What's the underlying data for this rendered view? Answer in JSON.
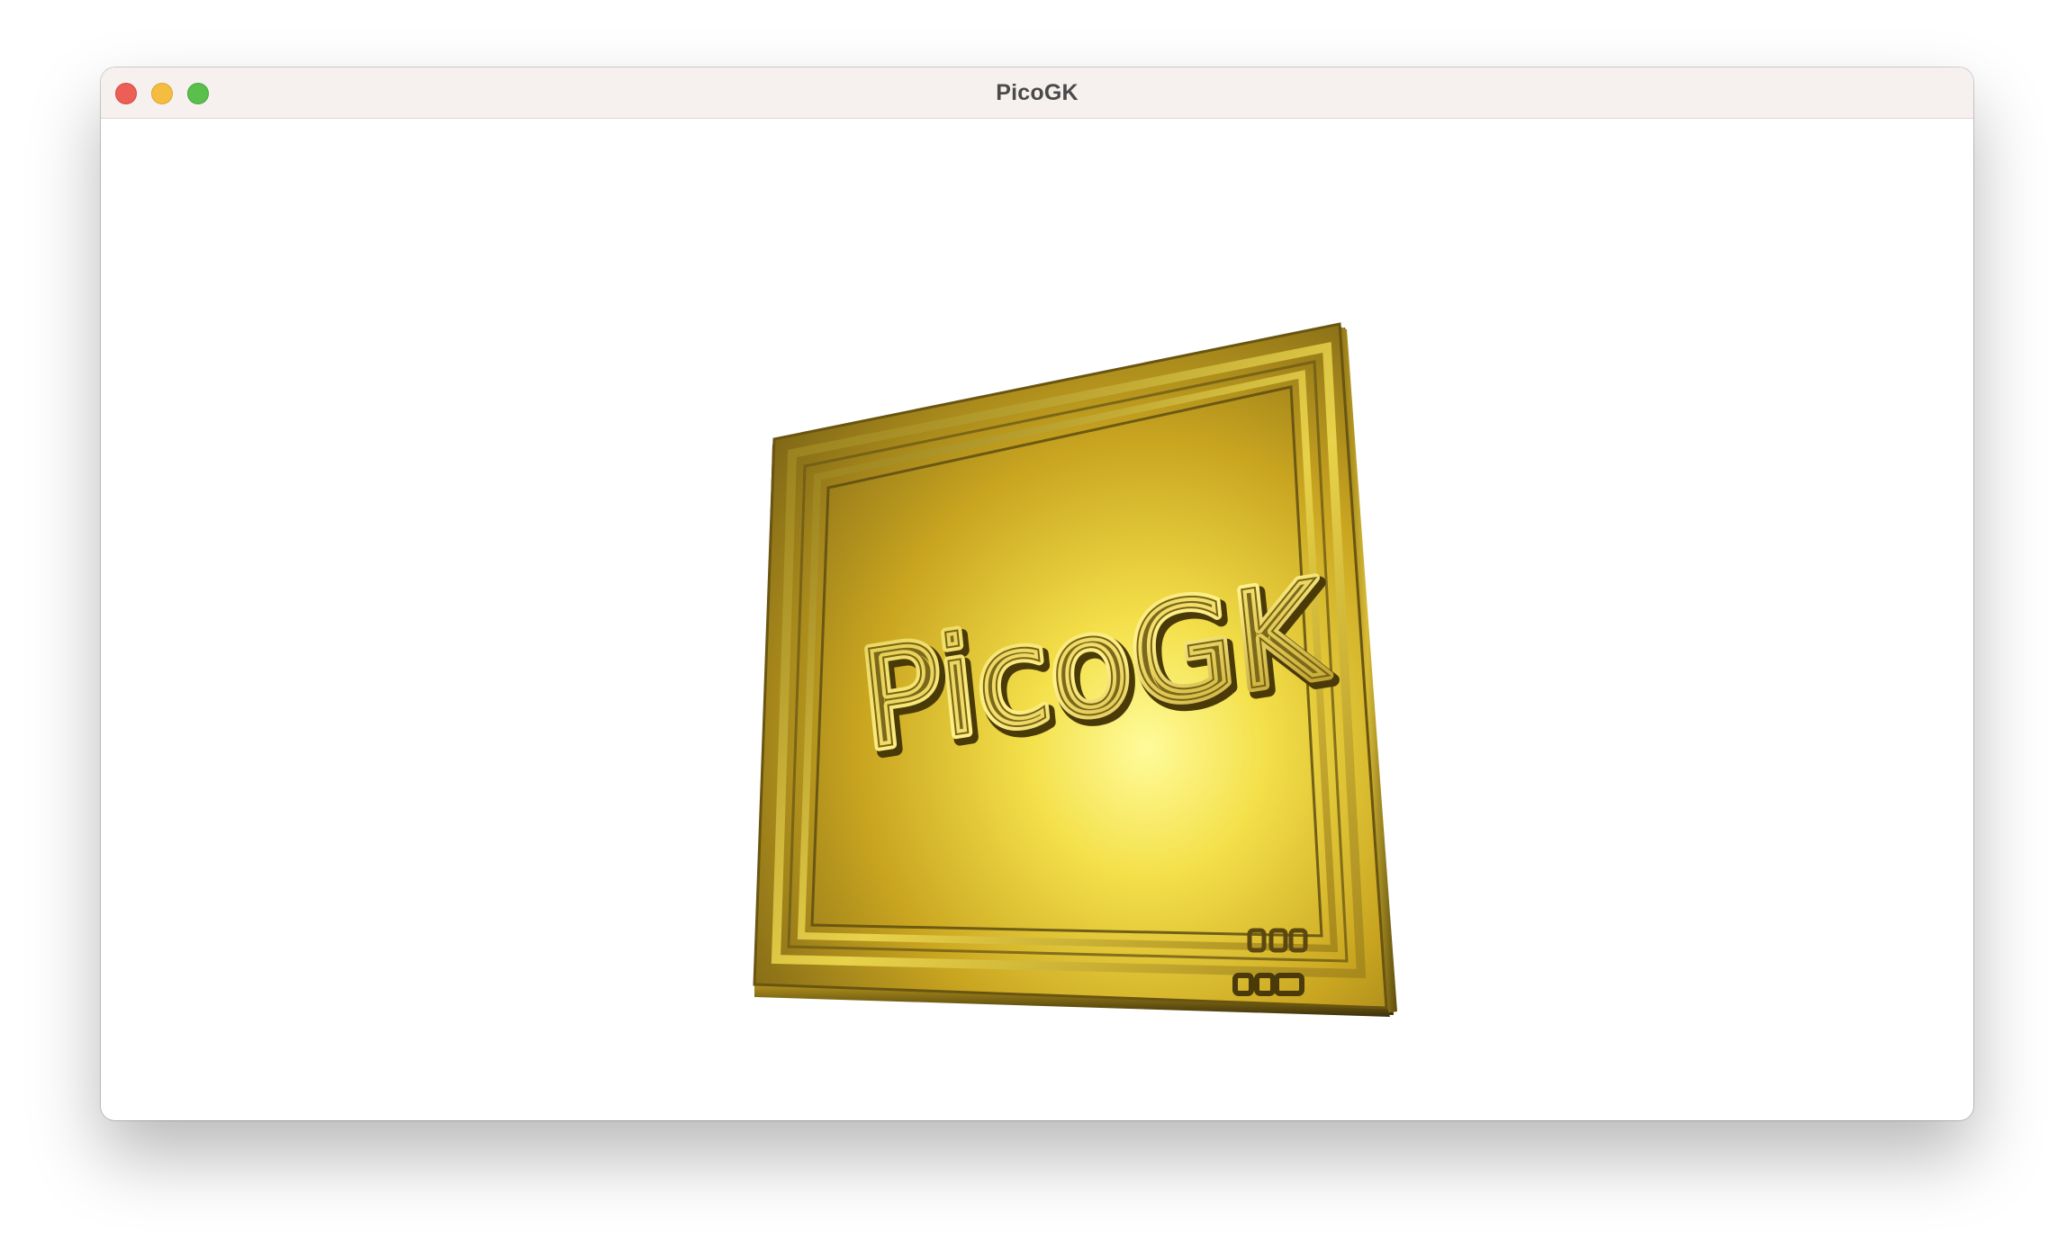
{
  "window": {
    "title": "PicoGK"
  },
  "viewport": {
    "model_text": "PicoGK",
    "material_color": "#c9a822",
    "highlight_color": "#fff57a",
    "shadow_color": "#6e5a14",
    "background": "#ffffff"
  },
  "colors": {
    "close": "#ec5f57",
    "minimize": "#f5bd3f",
    "zoom": "#5ac04b",
    "titlebar": "#f6f1ef"
  }
}
